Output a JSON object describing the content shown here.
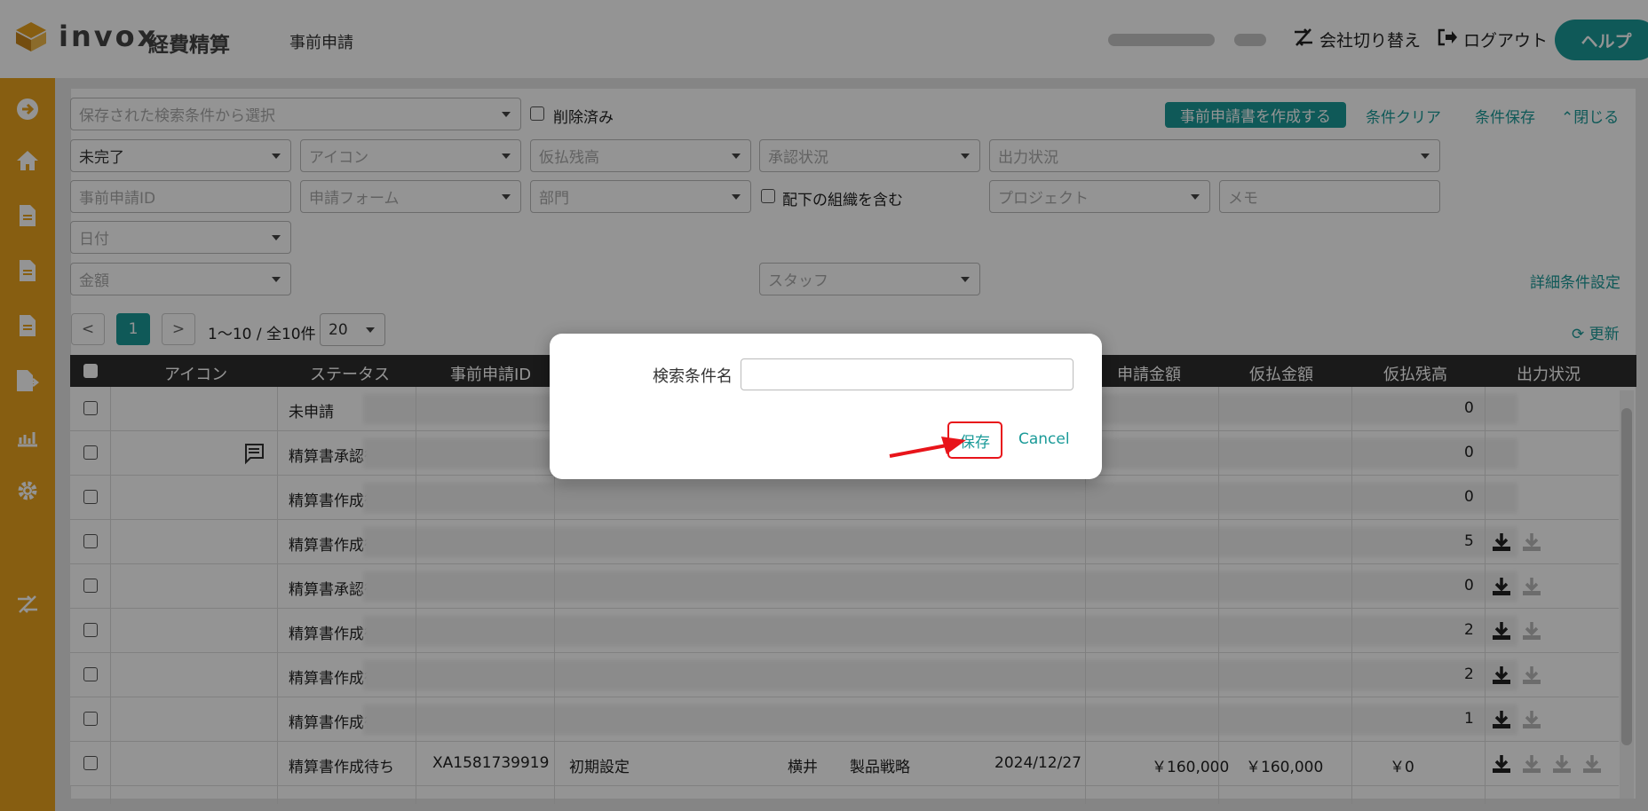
{
  "header": {
    "logo": "invox",
    "product": "経費精算",
    "page_title": "事前申請",
    "switch_company": "会社切り替え",
    "logout": "ログアウト",
    "help": "ヘルプ"
  },
  "filters": {
    "saved_search_placeholder": "保存された検索条件から選択",
    "deleted_label": "削除済み",
    "create_button": "事前申請書を作成する",
    "clear": "条件クリア",
    "save": "条件保存",
    "close": "閉じる",
    "status_value": "未完了",
    "icon_placeholder": "アイコン",
    "advance_balance_placeholder": "仮払残高",
    "approval_placeholder": "承認状況",
    "output_placeholder": "出力状況",
    "preapp_id_placeholder": "事前申請ID",
    "form_placeholder": "申請フォーム",
    "dept_placeholder": "部門",
    "include_sub_label": "配下の組織を含む",
    "project_placeholder": "プロジェクト",
    "memo_placeholder": "メモ",
    "date_placeholder": "日付",
    "amount_placeholder": "金額",
    "staff_placeholder": "スタッフ",
    "advanced": "詳細条件設定"
  },
  "pagination": {
    "prev": "<",
    "current": "1",
    "next": ">",
    "range": "1〜10 / 全10件",
    "per_page": "20",
    "refresh": "更新"
  },
  "table": {
    "headers": {
      "icon": "アイコン",
      "status": "ステータス",
      "id": "事前申請ID",
      "req_amount": "申請金額",
      "adv_amount": "仮払金額",
      "adv_balance": "仮払残高",
      "output": "出力状況"
    },
    "rows": [
      {
        "status": "未申請",
        "balance_tail": "0"
      },
      {
        "status": "精算書承認待ち",
        "balance_tail": "0"
      },
      {
        "status": "精算書作成待ち",
        "balance_tail": "0"
      },
      {
        "status": "精算書作成待ち",
        "balance_tail": "5"
      },
      {
        "status": "精算書承認待ち",
        "balance_tail": "0"
      },
      {
        "status": "精算書作成待ち",
        "balance_tail": "2"
      },
      {
        "status": "精算書作成待ち",
        "balance_tail": "2"
      },
      {
        "status": "精算書作成待ち",
        "balance_tail": "1"
      },
      {
        "status": "精算書作成待ち",
        "id": "XA1581739919",
        "form": "初期設定",
        "person": "横井",
        "dept": "製品戦略",
        "date": "2024/12/27",
        "req_amount": "￥160,000",
        "adv_amount": "￥160,000",
        "adv_balance": "￥0"
      }
    ]
  },
  "modal": {
    "label": "検索条件名",
    "value": "",
    "save": "保存",
    "cancel": "Cancel"
  },
  "colors": {
    "accent": "#1a9a98",
    "sidebar": "#e8a21e",
    "highlight": "#e8141a"
  }
}
